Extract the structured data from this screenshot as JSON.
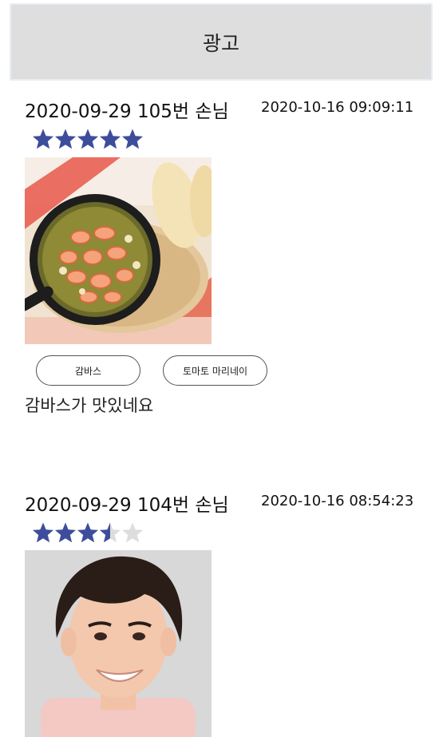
{
  "ad": {
    "label": "광고"
  },
  "accent_color": "#3e4d9b",
  "empty_star_color": "#dddddd",
  "reviews": [
    {
      "title": "2020-09-29 105번 손님",
      "timestamp": "2020-10-16 09:09:11",
      "rating": 5,
      "rating_max": 5,
      "photo_icon": "garlic-shrimp-photo",
      "menu_tags": [
        "감바스",
        "토마토 마리네이"
      ],
      "text": "감바스가 맛있네요"
    },
    {
      "title": "2020-09-29 104번 손님",
      "timestamp": "2020-10-16 08:54:23",
      "rating": 3.5,
      "rating_max": 5,
      "photo_icon": "person-photo",
      "menu_tags": [],
      "text": ""
    }
  ]
}
